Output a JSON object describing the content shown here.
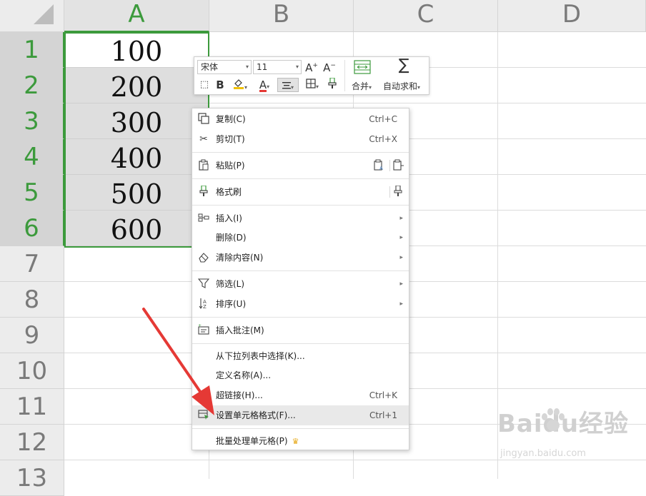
{
  "columns": [
    "A",
    "B",
    "C",
    "D"
  ],
  "rows": [
    "1",
    "2",
    "3",
    "4",
    "5",
    "6",
    "7",
    "8",
    "9",
    "10",
    "11",
    "12",
    "13"
  ],
  "cells": [
    "100",
    "200",
    "300",
    "400",
    "500",
    "600"
  ],
  "toolbar": {
    "font_name": "宋体",
    "font_size": "11",
    "merge_label": "合并",
    "autosum_label": "自动求和"
  },
  "menu": {
    "copy": {
      "label": "复制(C)",
      "shortcut": "Ctrl+C"
    },
    "cut": {
      "label": "剪切(T)",
      "shortcut": "Ctrl+X"
    },
    "paste": {
      "label": "粘贴(P)"
    },
    "format_painter": {
      "label": "格式刷"
    },
    "insert": {
      "label": "插入(I)"
    },
    "delete": {
      "label": "删除(D)"
    },
    "clear": {
      "label": "清除内容(N)"
    },
    "filter": {
      "label": "筛选(L)"
    },
    "sort": {
      "label": "排序(U)"
    },
    "comment": {
      "label": "插入批注(M)"
    },
    "pick_list": {
      "label": "从下拉列表中选择(K)..."
    },
    "define_name": {
      "label": "定义名称(A)..."
    },
    "hyperlink": {
      "label": "超链接(H)...",
      "shortcut": "Ctrl+K"
    },
    "format_cells": {
      "label": "设置单元格格式(F)...",
      "shortcut": "Ctrl+1"
    },
    "batch": {
      "label": "批量处理单元格(P)"
    }
  },
  "watermark": {
    "logo": "Baidu经验",
    "url": "jingyan.baidu.com"
  },
  "colors": {
    "selection": "#3c9a3c",
    "annotation_arrow": "#e53935",
    "highlight": "#e9e9e9"
  }
}
